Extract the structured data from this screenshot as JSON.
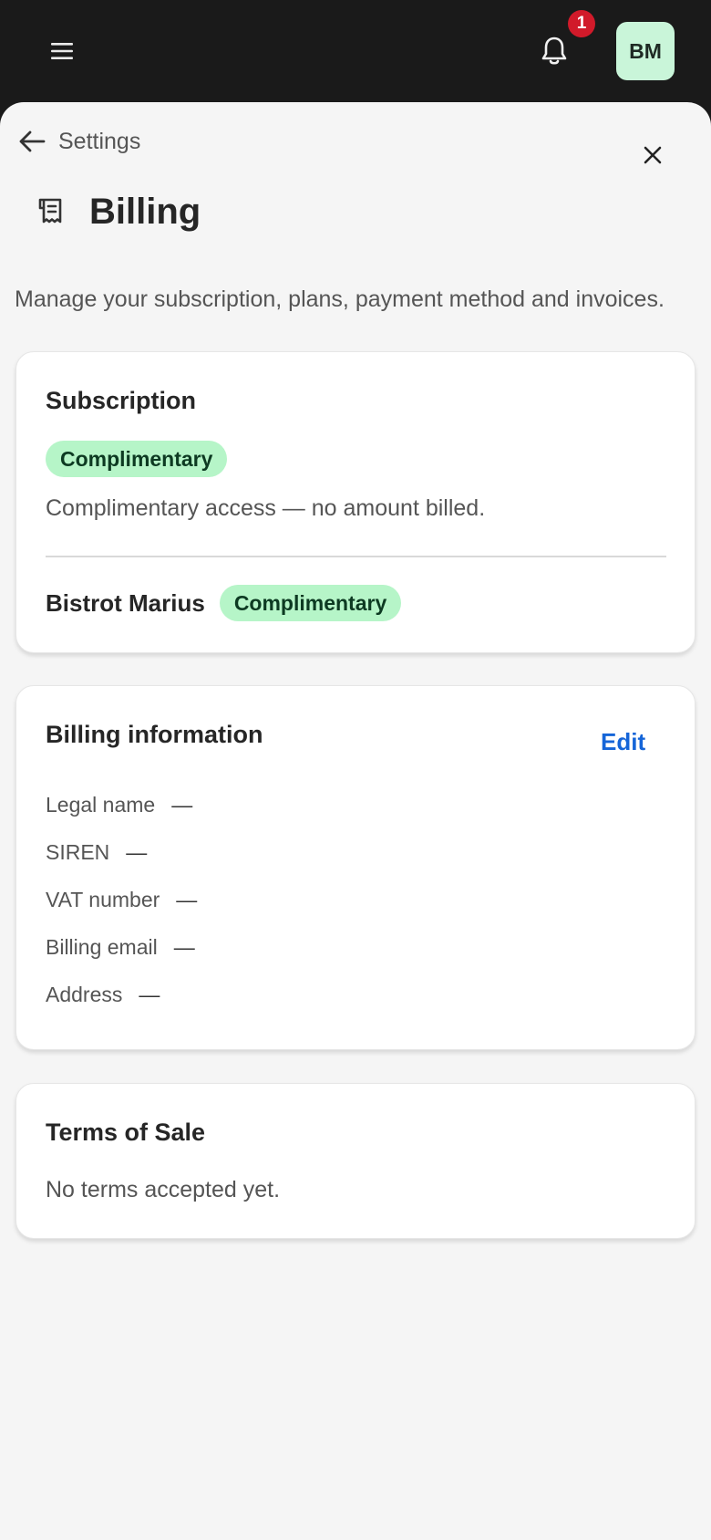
{
  "topbar": {
    "notification_count": "1",
    "avatar_initials": "BM"
  },
  "page": {
    "back_label": "Settings",
    "title": "Billing",
    "description": "Manage your subscription, plans, payment method and invoices."
  },
  "subscription": {
    "title": "Subscription",
    "status_badge": "Complimentary",
    "note": "Complimentary access — no amount billed.",
    "workspace_name": "Bistrot Marius",
    "workspace_badge": "Complimentary"
  },
  "billing_info": {
    "title": "Billing information",
    "edit_label": "Edit",
    "fields": [
      {
        "label": "Legal name",
        "value": "—"
      },
      {
        "label": "SIREN",
        "value": "—"
      },
      {
        "label": "VAT number",
        "value": "—"
      },
      {
        "label": "Billing email",
        "value": "—"
      },
      {
        "label": "Address",
        "value": "—"
      }
    ]
  },
  "terms": {
    "title": "Terms of Sale",
    "note": "No terms accepted yet."
  },
  "colors": {
    "topbar_bg": "#1a1a1a",
    "badge_red": "#d11a2a",
    "pill_green": "#b6f5c8",
    "link_blue": "#1565d8"
  }
}
